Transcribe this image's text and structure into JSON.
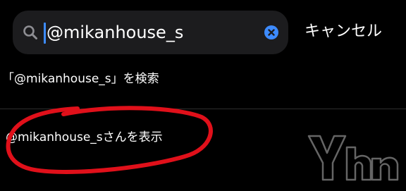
{
  "search": {
    "value": "@mikanhouse_s",
    "icon": "magnifying-glass-icon",
    "clear_icon": "clear-x-icon"
  },
  "cancel_label": "キャンセル",
  "suggestions": [
    {
      "label": "「@mikanhouse_s」を検索"
    },
    {
      "label": "@mikanhouse_sさんを表示"
    }
  ],
  "colors": {
    "background": "#000000",
    "search_field": "#1c1c1e",
    "accent": "#3d8bff",
    "annotation": "#e0101a"
  }
}
